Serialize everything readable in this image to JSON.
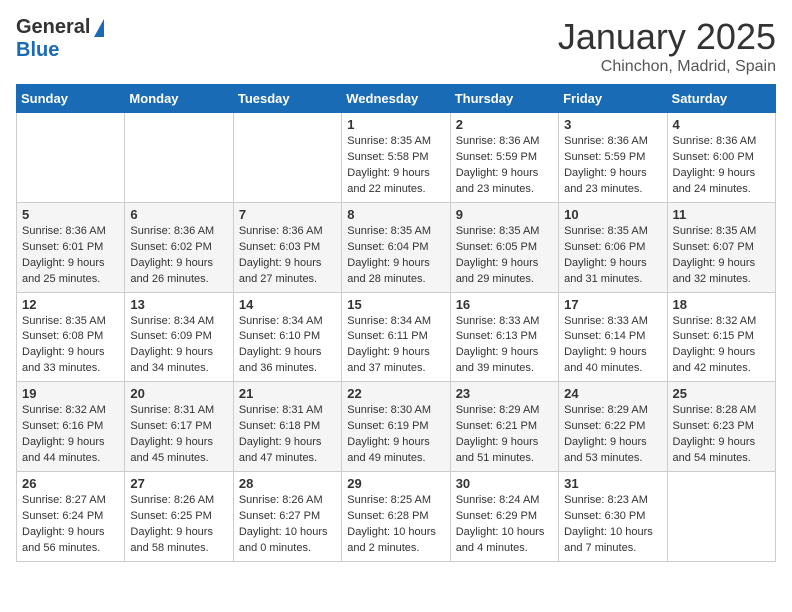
{
  "header": {
    "logo_general": "General",
    "logo_blue": "Blue",
    "title": "January 2025",
    "location": "Chinchon, Madrid, Spain"
  },
  "calendar": {
    "days_of_week": [
      "Sunday",
      "Monday",
      "Tuesday",
      "Wednesday",
      "Thursday",
      "Friday",
      "Saturday"
    ],
    "weeks": [
      [
        {
          "day": "",
          "info": ""
        },
        {
          "day": "",
          "info": ""
        },
        {
          "day": "",
          "info": ""
        },
        {
          "day": "1",
          "info": "Sunrise: 8:35 AM\nSunset: 5:58 PM\nDaylight: 9 hours\nand 22 minutes."
        },
        {
          "day": "2",
          "info": "Sunrise: 8:36 AM\nSunset: 5:59 PM\nDaylight: 9 hours\nand 23 minutes."
        },
        {
          "day": "3",
          "info": "Sunrise: 8:36 AM\nSunset: 5:59 PM\nDaylight: 9 hours\nand 23 minutes."
        },
        {
          "day": "4",
          "info": "Sunrise: 8:36 AM\nSunset: 6:00 PM\nDaylight: 9 hours\nand 24 minutes."
        }
      ],
      [
        {
          "day": "5",
          "info": "Sunrise: 8:36 AM\nSunset: 6:01 PM\nDaylight: 9 hours\nand 25 minutes."
        },
        {
          "day": "6",
          "info": "Sunrise: 8:36 AM\nSunset: 6:02 PM\nDaylight: 9 hours\nand 26 minutes."
        },
        {
          "day": "7",
          "info": "Sunrise: 8:36 AM\nSunset: 6:03 PM\nDaylight: 9 hours\nand 27 minutes."
        },
        {
          "day": "8",
          "info": "Sunrise: 8:35 AM\nSunset: 6:04 PM\nDaylight: 9 hours\nand 28 minutes."
        },
        {
          "day": "9",
          "info": "Sunrise: 8:35 AM\nSunset: 6:05 PM\nDaylight: 9 hours\nand 29 minutes."
        },
        {
          "day": "10",
          "info": "Sunrise: 8:35 AM\nSunset: 6:06 PM\nDaylight: 9 hours\nand 31 minutes."
        },
        {
          "day": "11",
          "info": "Sunrise: 8:35 AM\nSunset: 6:07 PM\nDaylight: 9 hours\nand 32 minutes."
        }
      ],
      [
        {
          "day": "12",
          "info": "Sunrise: 8:35 AM\nSunset: 6:08 PM\nDaylight: 9 hours\nand 33 minutes."
        },
        {
          "day": "13",
          "info": "Sunrise: 8:34 AM\nSunset: 6:09 PM\nDaylight: 9 hours\nand 34 minutes."
        },
        {
          "day": "14",
          "info": "Sunrise: 8:34 AM\nSunset: 6:10 PM\nDaylight: 9 hours\nand 36 minutes."
        },
        {
          "day": "15",
          "info": "Sunrise: 8:34 AM\nSunset: 6:11 PM\nDaylight: 9 hours\nand 37 minutes."
        },
        {
          "day": "16",
          "info": "Sunrise: 8:33 AM\nSunset: 6:13 PM\nDaylight: 9 hours\nand 39 minutes."
        },
        {
          "day": "17",
          "info": "Sunrise: 8:33 AM\nSunset: 6:14 PM\nDaylight: 9 hours\nand 40 minutes."
        },
        {
          "day": "18",
          "info": "Sunrise: 8:32 AM\nSunset: 6:15 PM\nDaylight: 9 hours\nand 42 minutes."
        }
      ],
      [
        {
          "day": "19",
          "info": "Sunrise: 8:32 AM\nSunset: 6:16 PM\nDaylight: 9 hours\nand 44 minutes."
        },
        {
          "day": "20",
          "info": "Sunrise: 8:31 AM\nSunset: 6:17 PM\nDaylight: 9 hours\nand 45 minutes."
        },
        {
          "day": "21",
          "info": "Sunrise: 8:31 AM\nSunset: 6:18 PM\nDaylight: 9 hours\nand 47 minutes."
        },
        {
          "day": "22",
          "info": "Sunrise: 8:30 AM\nSunset: 6:19 PM\nDaylight: 9 hours\nand 49 minutes."
        },
        {
          "day": "23",
          "info": "Sunrise: 8:29 AM\nSunset: 6:21 PM\nDaylight: 9 hours\nand 51 minutes."
        },
        {
          "day": "24",
          "info": "Sunrise: 8:29 AM\nSunset: 6:22 PM\nDaylight: 9 hours\nand 53 minutes."
        },
        {
          "day": "25",
          "info": "Sunrise: 8:28 AM\nSunset: 6:23 PM\nDaylight: 9 hours\nand 54 minutes."
        }
      ],
      [
        {
          "day": "26",
          "info": "Sunrise: 8:27 AM\nSunset: 6:24 PM\nDaylight: 9 hours\nand 56 minutes."
        },
        {
          "day": "27",
          "info": "Sunrise: 8:26 AM\nSunset: 6:25 PM\nDaylight: 9 hours\nand 58 minutes."
        },
        {
          "day": "28",
          "info": "Sunrise: 8:26 AM\nSunset: 6:27 PM\nDaylight: 10 hours\nand 0 minutes."
        },
        {
          "day": "29",
          "info": "Sunrise: 8:25 AM\nSunset: 6:28 PM\nDaylight: 10 hours\nand 2 minutes."
        },
        {
          "day": "30",
          "info": "Sunrise: 8:24 AM\nSunset: 6:29 PM\nDaylight: 10 hours\nand 4 minutes."
        },
        {
          "day": "31",
          "info": "Sunrise: 8:23 AM\nSunset: 6:30 PM\nDaylight: 10 hours\nand 7 minutes."
        },
        {
          "day": "",
          "info": ""
        }
      ]
    ]
  }
}
